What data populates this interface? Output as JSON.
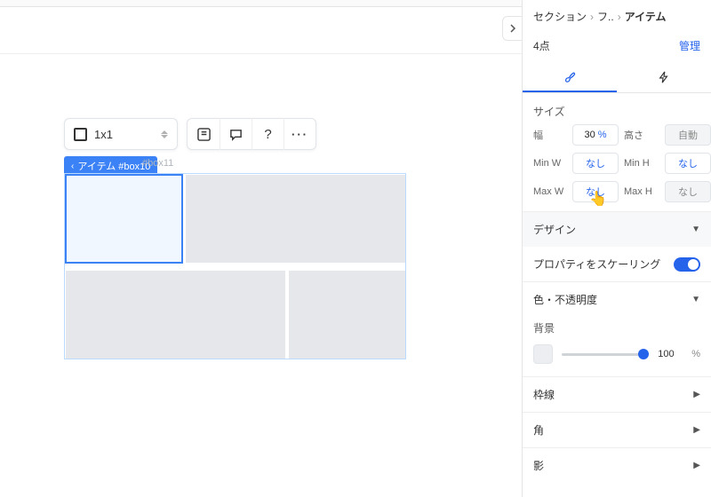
{
  "breadcrumbs": {
    "a": "セクション",
    "b": "フ..",
    "current": "アイテム",
    "sep": "›"
  },
  "points": {
    "label": "4点",
    "manage": "管理"
  },
  "toolbar": {
    "type_label": "1x1",
    "more": "···",
    "help": "?"
  },
  "selection": {
    "tag": "アイテム #box10",
    "next": "#box11"
  },
  "sections": {
    "size": "サイズ",
    "design": "デザイン",
    "scale_properties": "プロパティをスケーリング",
    "color_opacity": "色・不透明度",
    "background": "背景",
    "border": "枠線",
    "corner": "角",
    "shadow": "影"
  },
  "size": {
    "width_label": "幅",
    "width_value": "30",
    "width_unit": "%",
    "height_label": "高さ",
    "height_value": "自動",
    "minw_label": "Min W",
    "minw_value": "なし",
    "minh_label": "Min H",
    "minh_value": "なし",
    "maxw_label": "Max W",
    "maxw_value": "なし",
    "maxh_label": "Max H",
    "maxh_value": "なし"
  },
  "opacity": {
    "value": "100",
    "unit": "%"
  }
}
